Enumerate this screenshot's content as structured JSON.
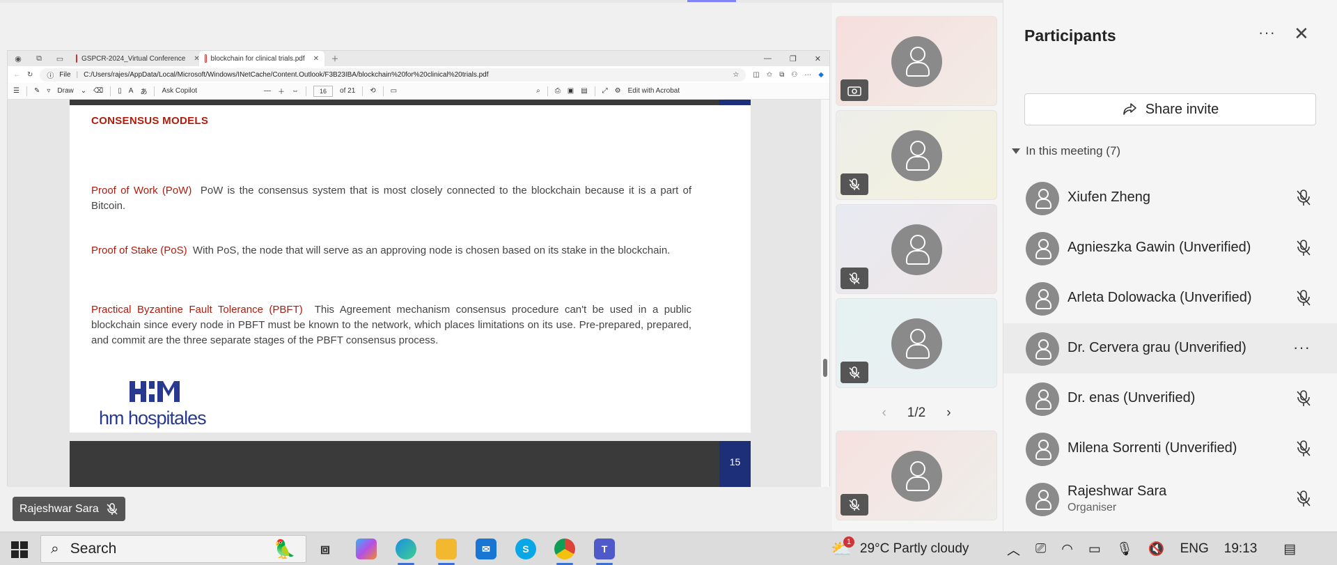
{
  "browser": {
    "tabs": [
      {
        "label": "GSPCR-2024_Virtual Conference"
      },
      {
        "label": "blockchain for clinical trials.pdf"
      }
    ],
    "address": {
      "prefix": "File",
      "url": "C:/Users/rajes/AppData/Local/Microsoft/Windows/INetCache/Content.Outlook/F3B23IBA/blockchain%20for%20clinical%20trials.pdf"
    },
    "pdf_toolbar": {
      "draw": "Draw",
      "ask": "Ask Copilot",
      "page": "16",
      "of": "of 21",
      "edit": "Edit with Acrobat"
    }
  },
  "slide": {
    "heading": "CONSENSUS MODELS",
    "items": [
      {
        "term": "Proof of Work (PoW)",
        "text": "PoW is the consensus system that is most closely connected to the blockchain because it is a part of Bitcoin."
      },
      {
        "term": "Proof of Stake (PoS)",
        "text": "With PoS, the node that will serve as an approving node is chosen based on its stake in the blockchain."
      },
      {
        "term": "Practical Byzantine Fault Tolerance (PBFT)",
        "text": "This Agreement mechanism consensus procedure can't be used in a public blockchain since every node in PBFT must be known to the network, which places limitations on its use. Pre-prepared, prepared, and commit are the three separate stages of the PBFT consensus process."
      }
    ],
    "logo_text": "hm hospitales",
    "next_slide_number": "15"
  },
  "presenter_tag": "Rajeshwar Sara",
  "gallery": {
    "pager": "1/2"
  },
  "participants": {
    "title": "Participants",
    "share_label": "Share invite",
    "section_label": "In this meeting (7)",
    "people": [
      {
        "name": "Xiufen Zheng",
        "role": ""
      },
      {
        "name": "Agnieszka Gawin (Unverified)",
        "role": ""
      },
      {
        "name": "Arleta Dolowacka (Unverified)",
        "role": ""
      },
      {
        "name": "Dr. Cervera grau (Unverified)",
        "role": ""
      },
      {
        "name": "Dr. enas (Unverified)",
        "role": ""
      },
      {
        "name": "Milena Sorrenti (Unverified)",
        "role": ""
      },
      {
        "name": "Rajeshwar Sara",
        "role": "Organiser"
      }
    ]
  },
  "taskbar": {
    "search": "Search",
    "weather": "29°C  Partly cloudy",
    "weather_badge": "1",
    "lang": "ENG",
    "time": "19:13"
  }
}
